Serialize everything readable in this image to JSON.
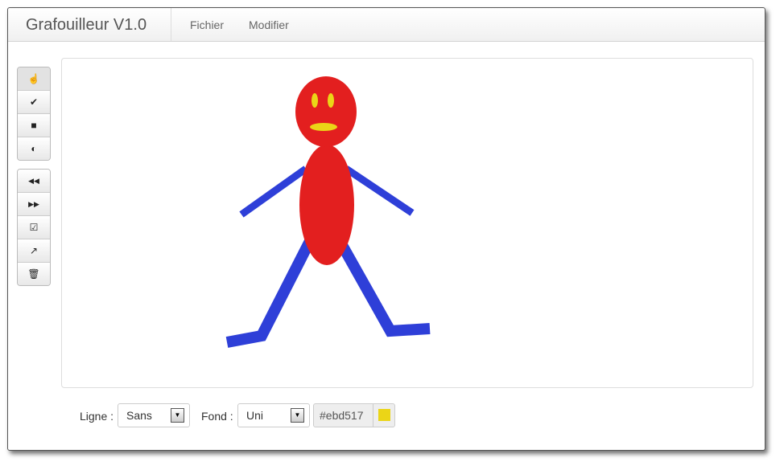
{
  "app": {
    "title": "Grafouilleur V1.0"
  },
  "menu": [
    {
      "label": "Fichier"
    },
    {
      "label": "Modifier"
    }
  ],
  "toolbar": {
    "group1": [
      {
        "icon": "hand-pointer-icon",
        "glyph": "☝",
        "active": true
      },
      {
        "icon": "check-icon",
        "glyph": "✔"
      },
      {
        "icon": "square-icon",
        "glyph": "■"
      },
      {
        "icon": "contrast-icon",
        "glyph": "◐"
      }
    ],
    "group2": [
      {
        "icon": "backward-icon",
        "glyph": "◀◀"
      },
      {
        "icon": "forward-icon",
        "glyph": "▶▶"
      },
      {
        "icon": "check-square-icon",
        "glyph": "☑"
      },
      {
        "icon": "share-icon",
        "glyph": "↗"
      },
      {
        "icon": "trash-icon",
        "glyph": "🗑"
      }
    ]
  },
  "bottom": {
    "line_label": "Ligne :",
    "line_value": "Sans",
    "fill_label": "Fond :",
    "fill_value": "Uni",
    "color_value": "#ebd517"
  },
  "colors": {
    "body": "#e31f1f",
    "limbs": "#2e3fd8",
    "features": "#ebd517"
  }
}
